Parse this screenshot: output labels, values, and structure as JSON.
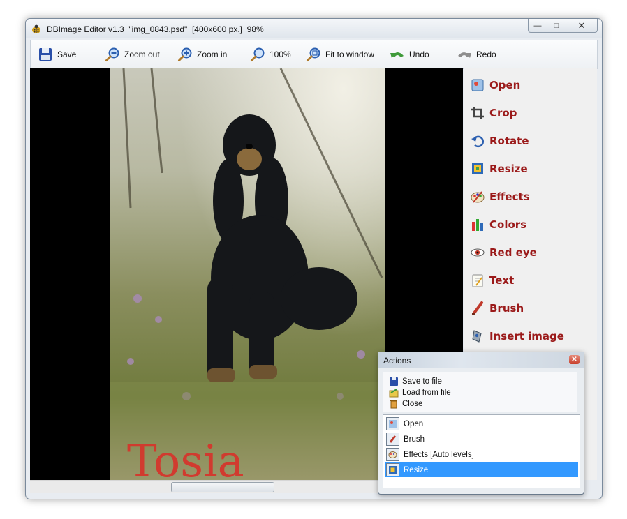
{
  "window": {
    "title": "DBImage Editor v1.3  \"img_0843.psd\"  [400x600 px.]  98%",
    "controls": [
      "minimize",
      "maximize",
      "close"
    ]
  },
  "toolbar": {
    "save": "Save",
    "zoom_out": "Zoom out",
    "zoom_in": "Zoom in",
    "zoom_100": "100%",
    "fit": "Fit to window",
    "undo": "Undo",
    "redo": "Redo"
  },
  "photo": {
    "overlay_text": "Tosia"
  },
  "sidebar": {
    "items": [
      {
        "label": "Open",
        "icon": "open-image-icon"
      },
      {
        "label": "Crop",
        "icon": "crop-icon"
      },
      {
        "label": "Rotate",
        "icon": "rotate-icon"
      },
      {
        "label": "Resize",
        "icon": "resize-icon"
      },
      {
        "label": "Effects",
        "icon": "palette-icon"
      },
      {
        "label": "Colors",
        "icon": "colors-bars-icon"
      },
      {
        "label": "Red eye",
        "icon": "eye-icon"
      },
      {
        "label": "Text",
        "icon": "text-note-icon"
      },
      {
        "label": "Brush",
        "icon": "brush-icon"
      },
      {
        "label": "Insert image",
        "icon": "insert-image-icon"
      }
    ]
  },
  "actions": {
    "title": "Actions",
    "menu": [
      "Save to file",
      "Load from file",
      "Close"
    ],
    "history": [
      "Open",
      "Brush",
      "Effects [Auto levels]",
      "Resize"
    ],
    "selected_index": 3
  },
  "colors": {
    "accent_text": "#9b1a1a",
    "selection": "#3399ff"
  }
}
